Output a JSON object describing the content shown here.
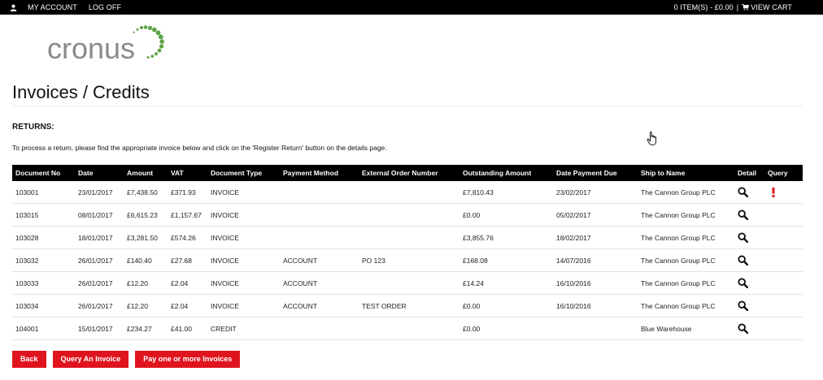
{
  "topbar": {
    "my_account": "MY ACCOUNT",
    "log_off": "LOG OFF",
    "cart_summary": "0 ITEM(S) - £0.00",
    "separator": "|",
    "view_cart": "VIEW CART",
    "icons": [
      "user-icon",
      "cart-icon"
    ]
  },
  "logo": {
    "text": "cronus",
    "color_text": "#8a8a8a",
    "color_dots": "#5da346"
  },
  "page": {
    "title": "Invoices / Credits",
    "section_heading": "RETURNS:",
    "instructions": "To process a return, please find the appropriate invoice below and click on the 'Register Return' button on the details page."
  },
  "table": {
    "headers": [
      "Document No",
      "Date",
      "Amount",
      "VAT",
      "Document Type",
      "Payment Method",
      "External Order Number",
      "Outstanding Amount",
      "Date Payment Due",
      "Ship to Name",
      "Detail",
      "Query"
    ],
    "rows": [
      {
        "doc_no": "103001",
        "date": "23/01/2017",
        "amount": "£7,438.50",
        "vat": "£371.93",
        "doc_type": "INVOICE",
        "payment_method": "",
        "external_order": "",
        "outstanding": "£7,810.43",
        "due": "23/02/2017",
        "ship_to": "The Cannon Group PLC",
        "query_flag": true
      },
      {
        "doc_no": "103015",
        "date": "08/01/2017",
        "amount": "£6,615.23",
        "vat": "£1,157.67",
        "doc_type": "INVOICE",
        "payment_method": "",
        "external_order": "",
        "outstanding": "£0.00",
        "due": "05/02/2017",
        "ship_to": "The Cannon Group PLC",
        "query_flag": false
      },
      {
        "doc_no": "103028",
        "date": "18/01/2017",
        "amount": "£3,281.50",
        "vat": "£574.26",
        "doc_type": "INVOICE",
        "payment_method": "",
        "external_order": "",
        "outstanding": "£3,855.76",
        "due": "18/02/2017",
        "ship_to": "The Cannon Group PLC",
        "query_flag": false
      },
      {
        "doc_no": "103032",
        "date": "26/01/2017",
        "amount": "£140.40",
        "vat": "£27.68",
        "doc_type": "INVOICE",
        "payment_method": "ACCOUNT",
        "external_order": "PO 123",
        "outstanding": "£168.08",
        "due": "14/07/2016",
        "ship_to": "The Cannon Group PLC",
        "query_flag": false
      },
      {
        "doc_no": "103033",
        "date": "26/01/2017",
        "amount": "£12.20",
        "vat": "£2.04",
        "doc_type": "INVOICE",
        "payment_method": "ACCOUNT",
        "external_order": "",
        "outstanding": "£14.24",
        "due": "16/10/2016",
        "ship_to": "The Cannon Group PLC",
        "query_flag": false
      },
      {
        "doc_no": "103034",
        "date": "26/01/2017",
        "amount": "£12.20",
        "vat": "£2.04",
        "doc_type": "INVOICE",
        "payment_method": "ACCOUNT",
        "external_order": "TEST ORDER",
        "outstanding": "£0.00",
        "due": "16/10/2016",
        "ship_to": "The Cannon Group PLC",
        "query_flag": false
      },
      {
        "doc_no": "104001",
        "date": "15/01/2017",
        "amount": "£234.27",
        "vat": "£41.00",
        "doc_type": "CREDIT",
        "payment_method": "",
        "external_order": "",
        "outstanding": "£0.00",
        "due": "",
        "ship_to": "Blue Warehouse",
        "query_flag": false
      }
    ],
    "detail_icon": "search-icon",
    "query_icon": "exclamation-icon"
  },
  "buttons": {
    "back": "Back",
    "query_invoice": "Query An Invoice",
    "pay_invoices": "Pay one or more Invoices"
  },
  "colors": {
    "accent_red": "#e0141e",
    "header_black": "#000000",
    "logo_green": "#5da346"
  }
}
